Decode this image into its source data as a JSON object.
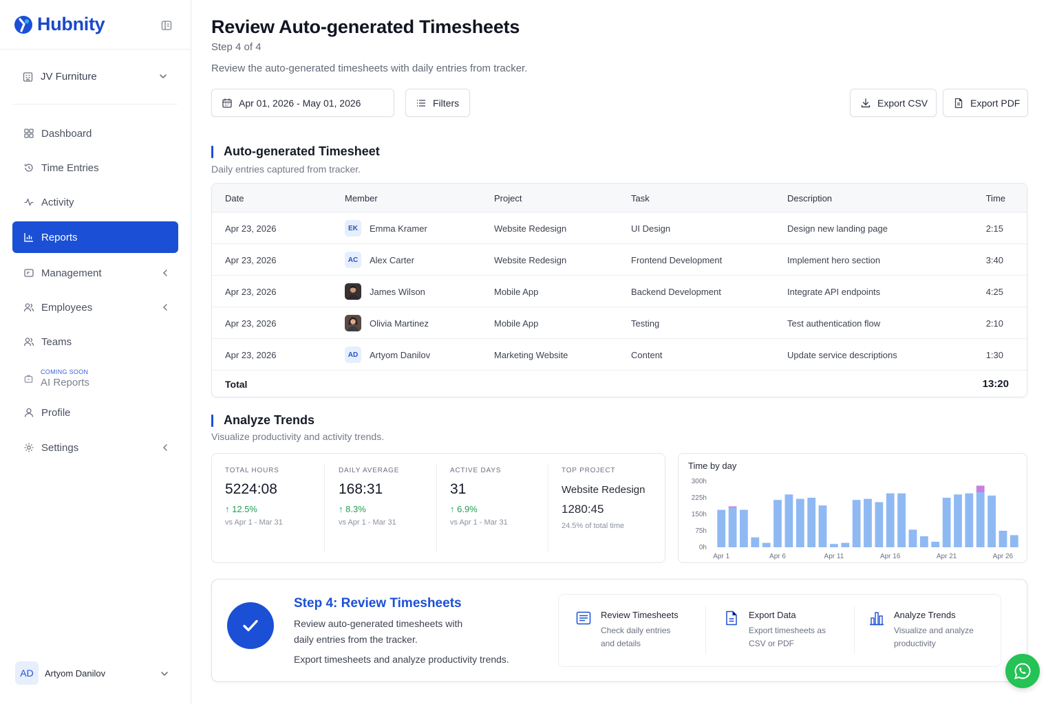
{
  "brand": {
    "name": "Hubnity",
    "accent": "#1b4fd6"
  },
  "sidebar": {
    "org": {
      "label": "JV Furniture",
      "icon": "building-icon"
    },
    "items": [
      {
        "label": "Dashboard",
        "icon": "grid-icon"
      },
      {
        "label": "Time Entries",
        "icon": "history-icon"
      },
      {
        "label": "Activity",
        "icon": "activity-icon"
      },
      {
        "label": "Reports",
        "icon": "bar-chart-icon",
        "active": true
      },
      {
        "label": "Management",
        "icon": "folder-icon",
        "expandable": true
      },
      {
        "label": "Employees",
        "icon": "users-icon",
        "expandable": true
      },
      {
        "label": "Teams",
        "icon": "team-icon"
      },
      {
        "label": "Profile",
        "icon": "user-icon"
      },
      {
        "label": "Settings",
        "icon": "gear-icon",
        "expandable": true
      }
    ],
    "coming_soon": {
      "tag": "COMING SOON",
      "label": "AI Reports",
      "icon": "lock-icon"
    },
    "user": {
      "initials": "AD",
      "name": "Artyom Danilov"
    }
  },
  "header": {
    "title": "Review Auto-generated Timesheets",
    "step": "Step 4 of 4",
    "description": "Review the auto-generated timesheets with daily entries from tracker."
  },
  "toolbar": {
    "date_range": "Apr 01, 2026 - May 01, 2026",
    "filters_label": "Filters",
    "export_csv_label": "Export CSV",
    "export_pdf_label": "Export PDF"
  },
  "timesheet": {
    "title": "Auto-generated Timesheet",
    "subtitle": "Daily entries captured from tracker.",
    "columns": [
      "Date",
      "Member",
      "Project",
      "Task",
      "Description",
      "Time"
    ],
    "rows": [
      {
        "date": "Apr 23, 2026",
        "initials": "EK",
        "member": "Emma Kramer",
        "project": "Website Redesign",
        "task": "UI Design",
        "description": "Design new landing page",
        "time": "2:15"
      },
      {
        "date": "Apr 23, 2026",
        "initials": "AC",
        "member": "Alex Carter",
        "project": "Website Redesign",
        "task": "Frontend Development",
        "description": "Implement hero section",
        "time": "3:40"
      },
      {
        "date": "Apr 23, 2026",
        "initials": "",
        "member": "James Wilson",
        "project": "Mobile App",
        "task": "Backend Development",
        "description": "Integrate API endpoints",
        "time": "4:25"
      },
      {
        "date": "Apr 23, 2026",
        "initials": "",
        "member": "Olivia Martinez",
        "project": "Mobile App",
        "task": "Testing",
        "description": "Test authentication flow",
        "time": "2:10"
      },
      {
        "date": "Apr 23, 2026",
        "initials": "AD",
        "member": "Artyom Danilov",
        "project": "Marketing Website",
        "task": "Content",
        "description": "Update service descriptions",
        "time": "1:30"
      }
    ],
    "total_label": "Total",
    "total_value": "13:20"
  },
  "trends": {
    "title": "Analyze Trends",
    "subtitle": "Visualize productivity and activity trends.",
    "stats": [
      {
        "caption": "TOTAL HOURS",
        "value": "5224:08",
        "delta": "12.5%",
        "compare": "vs Apr 1 - Mar 31"
      },
      {
        "caption": "DAILY AVERAGE",
        "value": "168:31",
        "delta": "8.3%",
        "compare": "vs Apr 1 - Mar 31"
      },
      {
        "caption": "ACTIVE DAYS",
        "value": "31",
        "delta": "6.9%",
        "compare": "vs Apr 1 - Mar 31"
      }
    ],
    "top_project": {
      "caption": "TOP PROJECT",
      "name": "Website Redesign",
      "hours": "1280:45",
      "share": "24.5% of total time"
    },
    "positive_color": "#1f9d55"
  },
  "chart_data": {
    "type": "bar",
    "title": "Time by day",
    "y_ticks": [
      "300h",
      "225h",
      "150h",
      "75h",
      "0h"
    ],
    "ylim": [
      0,
      300
    ],
    "x_labels": [
      "Apr 1",
      "Apr 6",
      "Apr 11",
      "Apr 16",
      "Apr 21",
      "Apr 26"
    ],
    "x_label_days": [
      1,
      6,
      11,
      16,
      21,
      26
    ],
    "days": [
      1,
      2,
      3,
      4,
      5,
      6,
      7,
      8,
      9,
      10,
      11,
      12,
      13,
      14,
      15,
      16,
      17,
      18,
      19,
      20,
      21,
      22,
      23,
      24,
      25,
      26,
      27,
      28,
      29,
      30
    ],
    "values": [
      170,
      180,
      170,
      45,
      20,
      215,
      240,
      220,
      225,
      190,
      15,
      20,
      215,
      220,
      205,
      245,
      245,
      80,
      50,
      25,
      225,
      240,
      245,
      250,
      235,
      75,
      55
    ],
    "accent_values": {
      "23": 30,
      "1": 6
    },
    "bar_color": "#8fb9f3",
    "accent_color": "#c77fe0",
    "grid": false
  },
  "step_card": {
    "title": "Step 4: Review Timesheets",
    "line1": "Review auto-generated timesheets with",
    "line2": "daily entries from the tracker.",
    "line3": "Export timesheets and analyze productivity trends.",
    "features": [
      {
        "title": "Review Timesheets",
        "l1": "Check daily entries",
        "l2": "and details",
        "icon": "list-icon"
      },
      {
        "title": "Export Data",
        "l1": "Export timesheets as",
        "l2": "CSV or PDF",
        "icon": "document-icon"
      },
      {
        "title": "Analyze Trends",
        "l1": "Visualize and analyze",
        "l2": "productivity",
        "icon": "chart-icon"
      }
    ]
  },
  "support": {
    "icon": "whatsapp-icon",
    "color": "#25c255"
  }
}
